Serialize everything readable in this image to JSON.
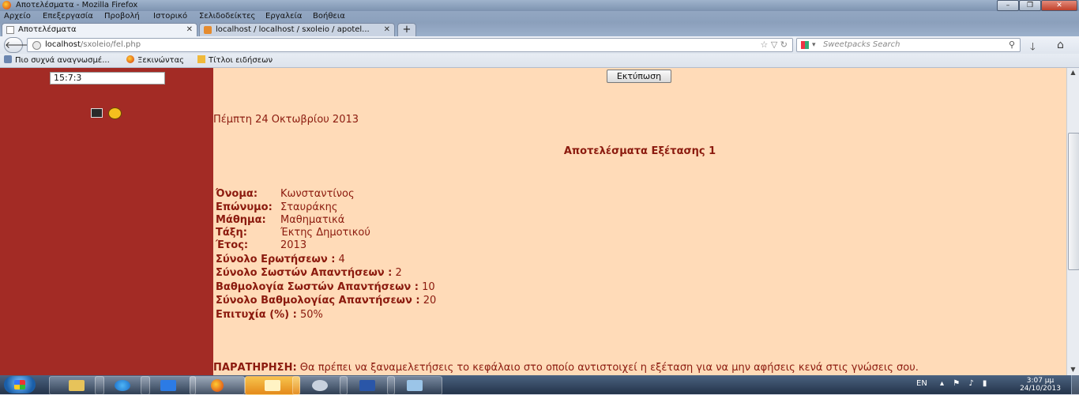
{
  "window": {
    "title": "Αποτελέσματα - Mozilla Firefox"
  },
  "menu": [
    "Αρχείο",
    "Επεξεργασία",
    "Προβολή",
    "Ιστορικό",
    "Σελιδοδείκτες",
    "Εργαλεία",
    "Βοήθεια"
  ],
  "tabs": [
    {
      "label": "Αποτελέσματα"
    },
    {
      "label": "localhost / localhost / sxoleio / apotel..."
    }
  ],
  "nav": {
    "url_host": "localhost",
    "url_path": "/sxoleio/fel.php",
    "search_placeholder": "Sweetpacks Search"
  },
  "bookmarks": [
    "Πιο συχνά αναγνωσμέ...",
    "Ξεκινώντας",
    "Τίτλοι ειδήσεων"
  ],
  "sidebar": {
    "clock": "15:7:3"
  },
  "page": {
    "print_button": "Εκτύπωση",
    "date": "Πέμπτη 24 Οκτωβρίου 2013",
    "heading": "Αποτελέσματα Εξέτασης 1",
    "fields": [
      {
        "label": "Όνομα:",
        "value": "Κωνσταντίνος"
      },
      {
        "label": "Επώνυμο:",
        "value": "Σταυράκης"
      },
      {
        "label": "Μάθημα:",
        "value": "Μαθηματικά"
      },
      {
        "label": "Τάξη:",
        "value": "Έκτης Δημοτικού"
      },
      {
        "label": "Έτος:",
        "value": "2013"
      }
    ],
    "stats": [
      {
        "label": "Σύνολο Ερωτήσεων :",
        "value": "4"
      },
      {
        "label": "Σύνολο Σωστών Απαντήσεων :",
        "value": "2"
      },
      {
        "label": "Βαθμολογία Σωστών Απαντήσεων :",
        "value": "10"
      },
      {
        "label": "Σύνολο Βαθμολογίας Απαντήσεων :",
        "value": "20"
      },
      {
        "label": "Επιτυχία (%) :",
        "value": "50%"
      }
    ],
    "note_label": "ΠΑΡΑΤΗΡΗΣΗ:",
    "note_text": "Θα πρέπει να ξαναμελετήσεις το κεφάλαιο στο οποίο αντιστοιχεί η εξέταση για να μην αφήσεις κενά στις γνώσεις σου."
  },
  "taskbar": {
    "lang": "EN",
    "time": "3:07 μμ",
    "date": "24/10/2013"
  },
  "colors": {
    "sidebar_bg": "#a32b25",
    "content_bg": "#ffdbb8",
    "content_text": "#8b1a0e"
  }
}
